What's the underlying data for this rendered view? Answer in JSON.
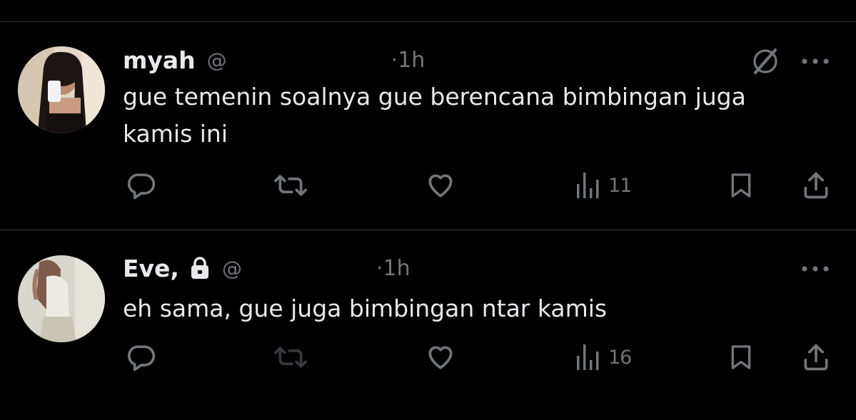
{
  "colors": {
    "background": "#000000",
    "text_primary": "#e7e9ea",
    "text_secondary": "#71767b",
    "divider": "#2f3336"
  },
  "tweets": [
    {
      "name": "myah",
      "handle_prefix": "@",
      "time": "·1h",
      "text": "gue temenin soalnya gue berencana bimbingan juga kamis ini",
      "protected": false,
      "views": "11"
    },
    {
      "name": "Eve,",
      "handle_prefix": "@",
      "time": "·1h",
      "text": "eh sama, gue juga bimbingan ntar kamis",
      "protected": true,
      "views": "16"
    }
  ]
}
